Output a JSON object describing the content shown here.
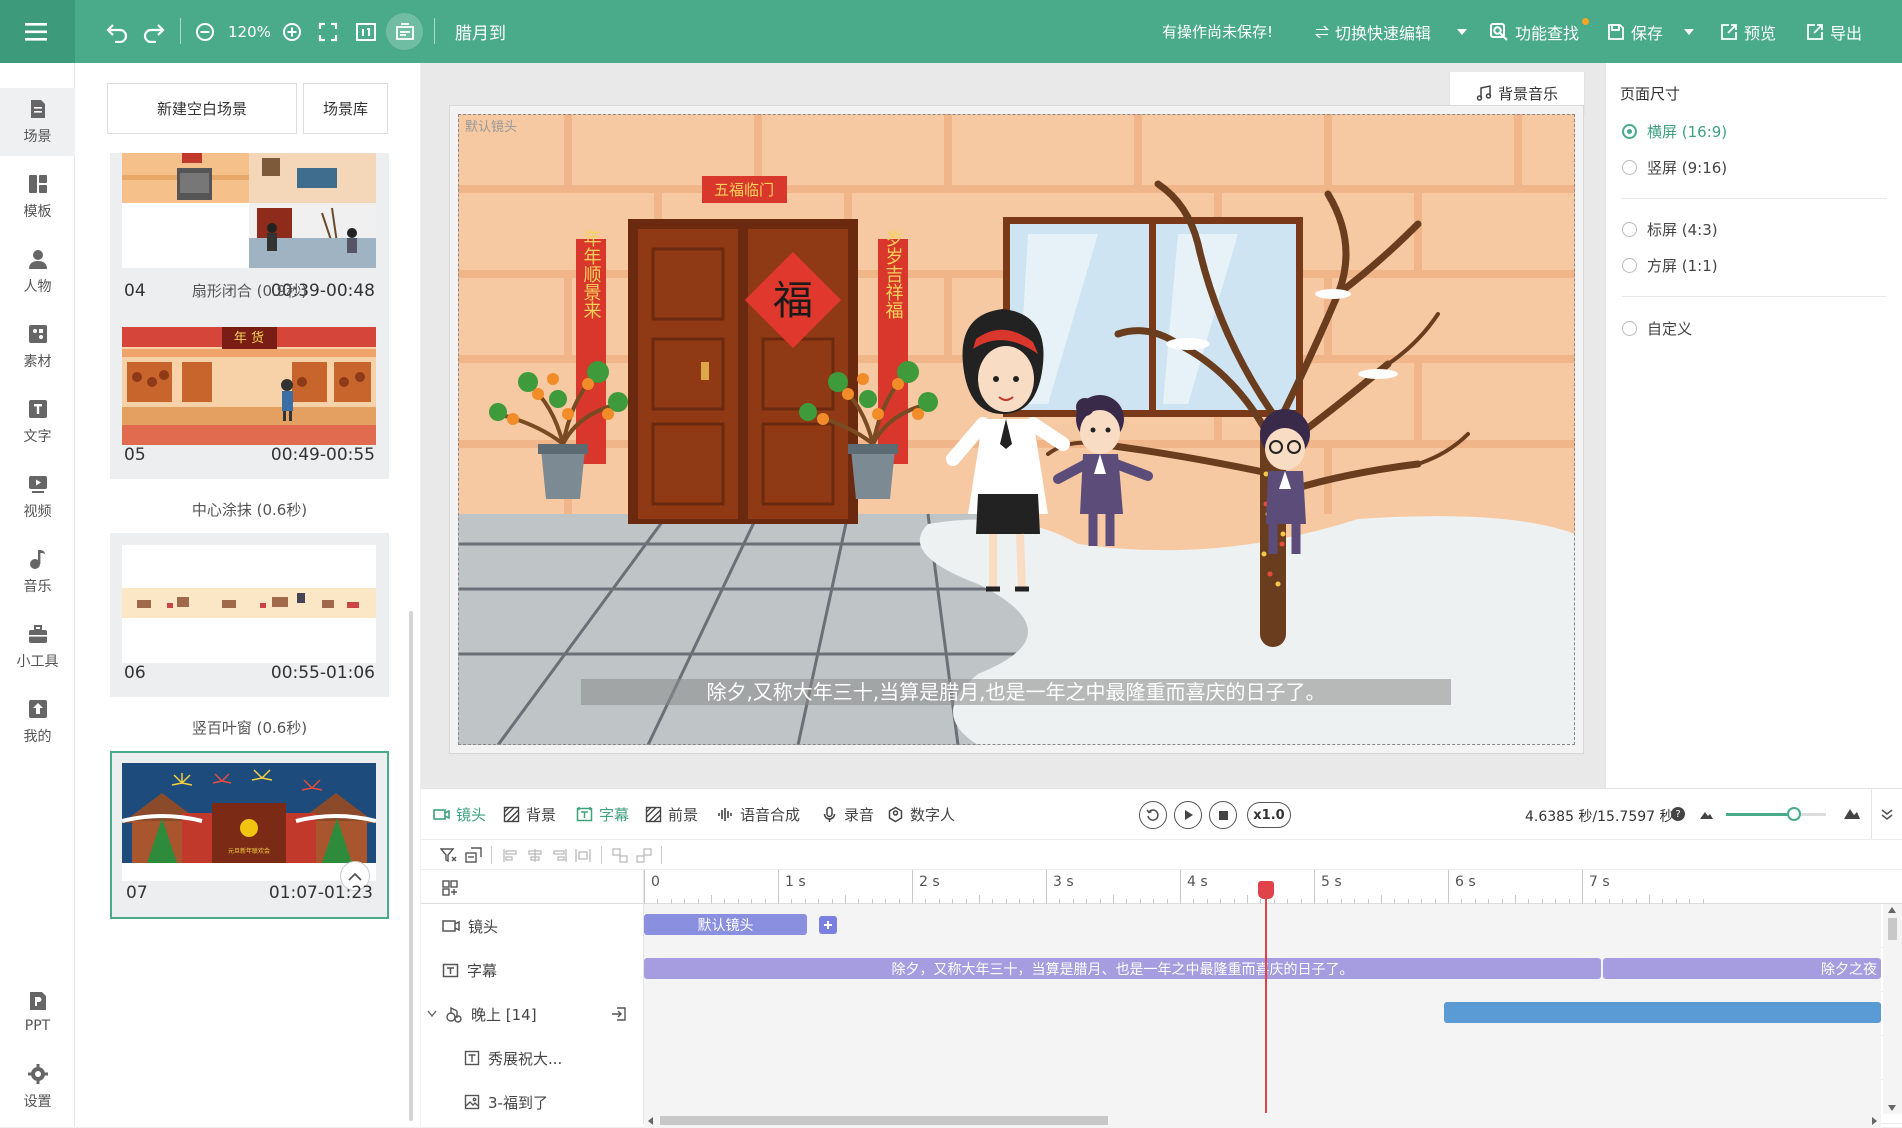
{
  "header": {
    "zoom": "120%",
    "project_title": "腊月到",
    "unsaved_notice": "有操作尚未保存!",
    "quick_edit": "切换快速编辑",
    "feature_search": "功能查找",
    "save": "保存",
    "preview": "预览",
    "export": "导出",
    "accent_color": "#4aab8a"
  },
  "nav": [
    {
      "label": "场景",
      "icon": "scene-icon"
    },
    {
      "label": "模板",
      "icon": "template-icon"
    },
    {
      "label": "人物",
      "icon": "person-icon"
    },
    {
      "label": "素材",
      "icon": "material-icon"
    },
    {
      "label": "文字",
      "icon": "text-icon"
    },
    {
      "label": "视频",
      "icon": "video-icon"
    },
    {
      "label": "音乐",
      "icon": "music-icon"
    },
    {
      "label": "小工具",
      "icon": "toolbox-icon"
    },
    {
      "label": "我的",
      "icon": "upload-icon"
    },
    {
      "label": "PPT",
      "icon": "ppt-icon"
    },
    {
      "label": "设置",
      "icon": "gear-icon"
    }
  ],
  "scene_panel": {
    "new_blank": "新建空白场景",
    "library": "场景库",
    "scenes": [
      {
        "num": "04",
        "time": "00:39-00:48"
      },
      {
        "num": "05",
        "time": "00:49-00:55"
      },
      {
        "num": "06",
        "time": "00:55-01:06"
      },
      {
        "num": "07",
        "time": "01:07-01:23"
      }
    ],
    "transitions": [
      "扇形闭合 (0.9秒)",
      "中心涂抹 (0.6秒)",
      "竖百叶窗 (0.6秒)"
    ],
    "market_sign": "年 货",
    "festival_banner": "元旦新年联欢会"
  },
  "stage": {
    "bgm": "背景音乐",
    "camera_label": "默认镜头",
    "door_banner": "五福临门",
    "fu": "福",
    "couplet_left": "年年顺景来",
    "couplet_right": "岁岁吉祥福",
    "subtitle": "除夕,又称大年三十,当算是腊月,也是一年之中最隆重而喜庆的日子了。"
  },
  "size_panel": {
    "title": "页面尺寸",
    "options": [
      "横屏 (16:9)",
      "竖屏 (9:16)",
      "标屏 (4:3)",
      "方屏 (1:1)",
      "自定义"
    ],
    "selected": "横屏 (16:9)"
  },
  "timeline": {
    "tabs": [
      "镜头",
      "背景",
      "字幕",
      "前景",
      "语音合成",
      "录音",
      "数字人"
    ],
    "active_tab": "字幕",
    "speed": "x1.0",
    "time_readout": "4.6385 秒/15.7597 秒",
    "ruler": [
      "0",
      "1 s",
      "2 s",
      "3 s",
      "4 s",
      "5 s",
      "6 s",
      "7 s"
    ],
    "tracks": [
      {
        "label": "镜头",
        "icon": "camera-icon"
      },
      {
        "label": "字幕",
        "icon": "subtitle-icon"
      },
      {
        "label": "晚上 [14]",
        "icon": "character-icon"
      },
      {
        "label": "秀展祝大...",
        "icon": "text-box-icon"
      },
      {
        "label": "3-福到了",
        "icon": "image-icon"
      }
    ],
    "camera_block": "默认镜头",
    "subtitle_block_1": "除夕，又称大年三十，当算是腊月、也是一年之中最隆重而喜庆的日子了。",
    "subtitle_block_2": "除夕之夜",
    "playhead_seconds": 4.6385,
    "total_seconds": 15.7597
  }
}
